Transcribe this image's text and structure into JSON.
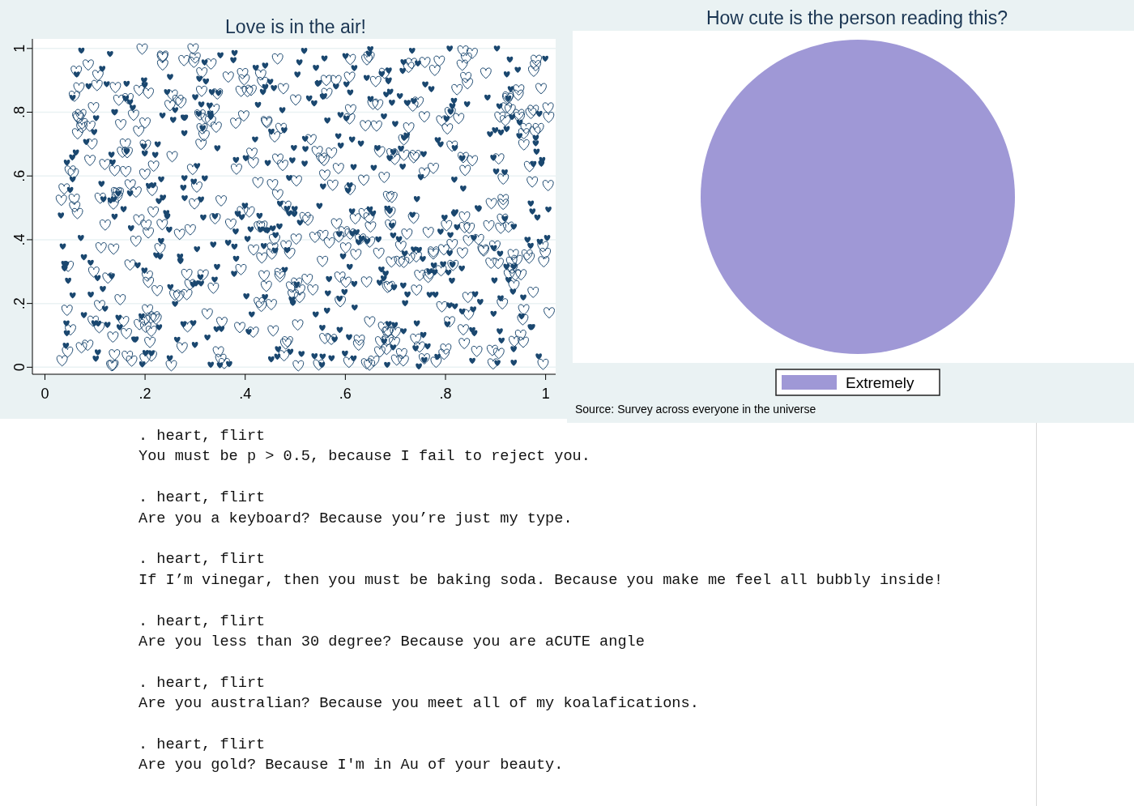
{
  "scatter_graph": {
    "chart_data": {
      "type": "scatter",
      "title": "Love is in the air!",
      "xlim": [
        -0.025,
        1.02
      ],
      "ylim": [
        -0.022,
        1.03
      ],
      "grid": true,
      "xticks": [
        {
          "value": 0,
          "label": "0"
        },
        {
          "value": 0.2,
          "label": ".2"
        },
        {
          "value": 0.4,
          "label": ".4"
        },
        {
          "value": 0.6,
          "label": ".6"
        },
        {
          "value": 0.8,
          "label": ".8"
        },
        {
          "value": 1,
          "label": "1"
        }
      ],
      "yticks": [
        {
          "value": 0,
          "label": "0"
        },
        {
          "value": 0.2,
          "label": ".2"
        },
        {
          "value": 0.4,
          "label": ".4"
        },
        {
          "value": 0.6,
          "label": ".6"
        },
        {
          "value": 0.8,
          "label": ".8"
        },
        {
          "value": 1,
          "label": "1"
        }
      ]
    }
  },
  "pie_graph": {
    "chart_data": {
      "type": "pie",
      "title": "How cute is the person reading this?",
      "categories": [
        "Extremely"
      ],
      "series": [
        {
          "color": "#9f98d6",
          "values": [
            100
          ]
        }
      ]
    },
    "note": "Source: Survey across everyone in the universe"
  },
  "log": [
    {
      "command": ". heart, flirt",
      "output": "You must be p > 0.5, because I fail to reject you."
    },
    {
      "command": ". heart, flirt",
      "output": "Are you a keyboard? Because you’re just my type."
    },
    {
      "command": ". heart, flirt",
      "output": "If I’m vinegar, then you must be baking soda. Because you make me feel all bubbly inside!"
    },
    {
      "command": ". heart, flirt",
      "output": "Are you less than 30 degree? Because you are aCUTE angle"
    },
    {
      "command": ". heart, flirt",
      "output": "Are you australian? Because you meet all of my koalafications."
    },
    {
      "command": ". heart, flirt",
      "output": "Are you gold? Because I'm in Au of your beauty."
    }
  ]
}
